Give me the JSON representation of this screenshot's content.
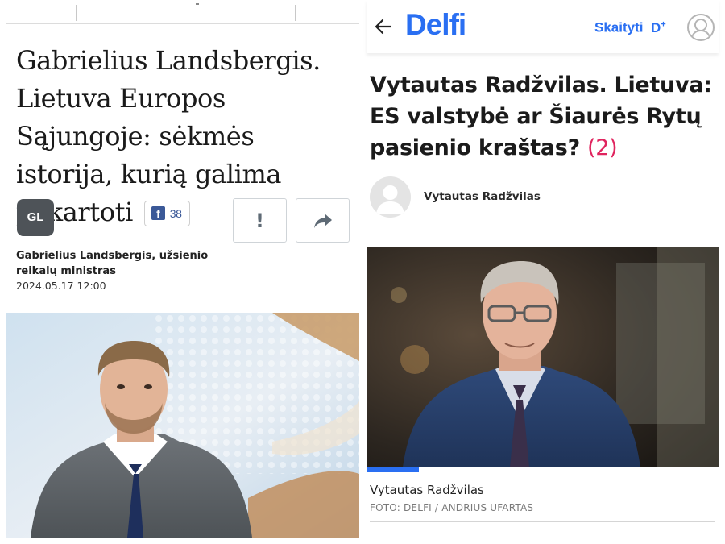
{
  "left_article": {
    "title": "Gabrielius Landsbergis. Lietuva Europos Sąjungoje: sėkmės istorija, kurią galima pakartoti",
    "facebook_icon": "facebook-icon",
    "facebook_count": "38",
    "avatar_initials": "GL",
    "report_button_label": "!",
    "share_icon": "share-arrow-icon",
    "author": "Gabrielius Landsbergis, užsienio reikalų ministras",
    "date": "2024.05.17 12:00"
  },
  "right_article": {
    "header": {
      "back_icon": "back-arrow-icon",
      "logo": "Delfi",
      "read_link": "Skaityti",
      "read_link_suffix": "D",
      "read_link_sup": "+",
      "user_icon": "user-icon"
    },
    "title": "Vytautas Radžvilas. Lietuva: ES valstybė ar Šiaurės Rytų pasienio kraštas?",
    "comment_count": "(2)",
    "author": "Vytautas Radžvilas",
    "photo_caption": "Vytautas Radžvilas",
    "photo_credit": "FOTO: DELFI / ANDRIUS UFARTAS"
  },
  "colors": {
    "brand_blue": "#2a6ff2",
    "facebook_blue": "#3b5998",
    "comment_red": "#e0245e"
  }
}
